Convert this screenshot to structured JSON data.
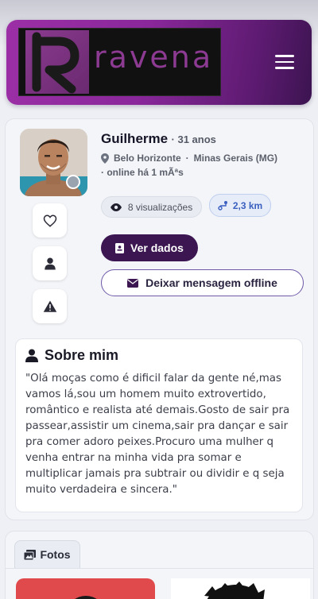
{
  "header": {
    "logo_text": "ravena",
    "logo_icon": "R",
    "menu_icon": "hamburger-icon"
  },
  "profile": {
    "name": "Guilherme",
    "age": "· 31 anos",
    "city": "Belo Horizonte",
    "separator": "·",
    "state": "Minas Gerais (MG)",
    "online": "· online há 1 mÃªs",
    "status_color": "#9aa4b1",
    "views": "8 visualizações",
    "distance": "2,3 km",
    "btn_dados": "Ver dados",
    "btn_message": "Deixar mensagem offline"
  },
  "side_actions": [
    {
      "icon": "heart-icon"
    },
    {
      "icon": "user-icon"
    },
    {
      "icon": "warning-icon"
    }
  ],
  "about": {
    "title": "Sobre mim",
    "text": "\"Olá moças como é dificil falar da gente né,mas vamos lá,sou um homem muito extrovertido, romântico e realista até demais.Gosto de sair pra passear,assistir um cinema,sair pra dançar e sair pra comer adoro peixes.Procuro uma mulher q venha entrar na minha vida pra somar e multiplicar jamais pra subtrair ou dividir e q seja muito verdadeira e sincera.\""
  },
  "photos": {
    "tab_label": "Fotos"
  },
  "colors": {
    "brand": "#8a279b",
    "primary_button": "#3b1650",
    "distance_accent": "#3a60c0"
  }
}
